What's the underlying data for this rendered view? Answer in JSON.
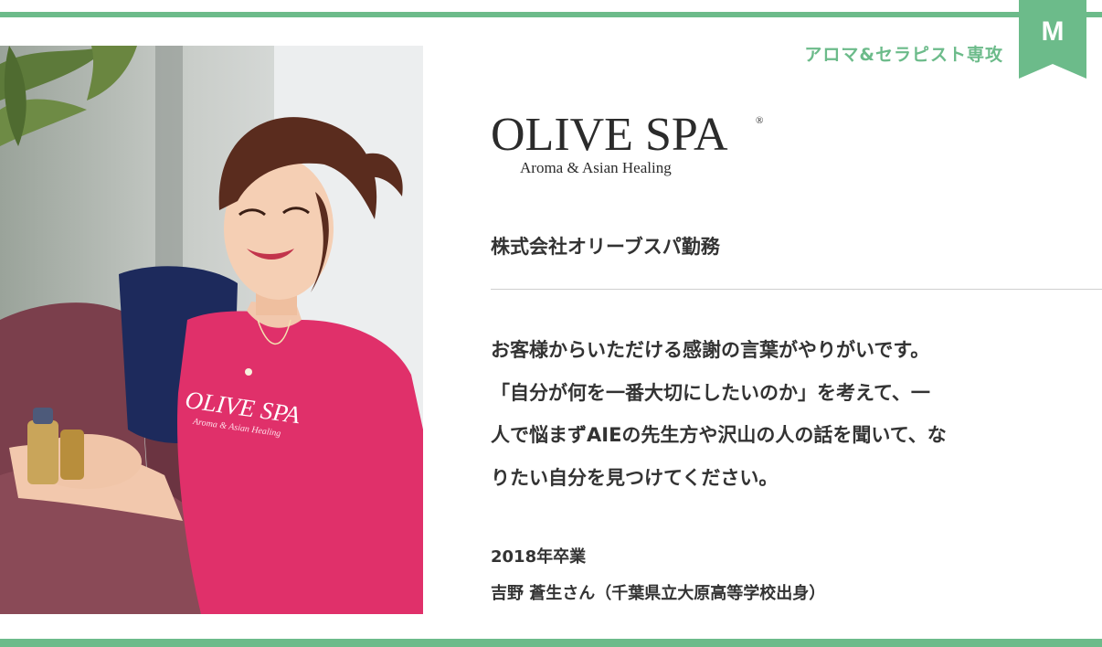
{
  "theme": {
    "accent": "#6cbb8a",
    "text": "#333333",
    "divider": "#cfcfcf",
    "shirt": "#e0306a"
  },
  "badge": {
    "letter": "M"
  },
  "course_label": "アロマ&セラピスト専攻",
  "logo": {
    "main": "OLIVE SPA",
    "registered": "®",
    "tagline": "Aroma & Asian Healing"
  },
  "photo": {
    "shirt_text": "OLIVE SPA",
    "shirt_subtext": "Aroma & Asian Healing"
  },
  "company": "株式会社オリーブスパ勤務",
  "message_lines": [
    "お客様からいただける感謝の言葉がやりがいです。",
    "「自分が何を一番大切にしたいのか」を考えて、一",
    "人で悩まずAIEの先生方や沢山の人の話を聞いて、な",
    "りたい自分を見つけてください。"
  ],
  "graduate": {
    "year": "2018年卒業",
    "name": "吉野 蒼生さん（千葉県立大原高等学校出身）"
  }
}
